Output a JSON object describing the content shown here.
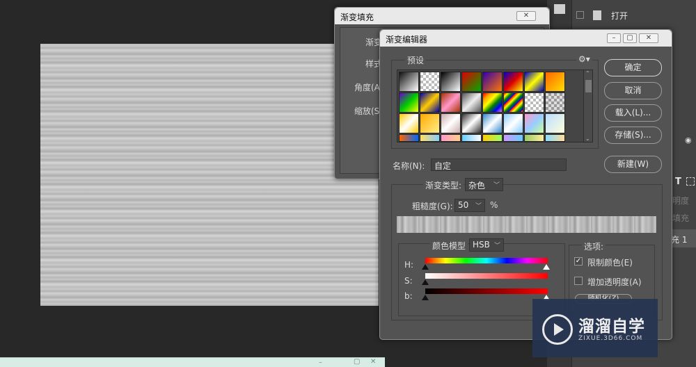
{
  "right_panel": {
    "open_label": "打开",
    "partial_labels": [
      "明度",
      "填充",
      "充 1"
    ],
    "partial_letters": "T"
  },
  "gradient_fill": {
    "title": "渐变填充",
    "labels": [
      "渐变",
      "样式",
      "角度(A)",
      "缩放(S)"
    ]
  },
  "editor": {
    "title": "渐变编辑器",
    "presets_label": "预设",
    "buttons": {
      "ok": "确定",
      "cancel": "取消",
      "load": "载入(L)...",
      "save": "存储(S)...",
      "new": "新建(W)"
    },
    "name_label": "名称(N):",
    "name_value": "自定",
    "type_label": "渐变类型:",
    "type_value": "杂色",
    "roughness_label": "粗糙度(G):",
    "roughness_value": "50",
    "roughness_unit": "%",
    "color_model_label": "颜色模型",
    "color_model_value": "HSB",
    "channels": [
      "H:",
      "S:",
      "b:"
    ],
    "options_label": "选项:",
    "restrict_colors": "限制颜色(E)",
    "add_transparency": "增加透明度(A)",
    "randomize": "随机化(Z)"
  },
  "watermark": {
    "brand": "溜溜自学",
    "site": "ZIXUE.3D66.COM"
  },
  "colors": {
    "dialog_bg": "#535353",
    "titlebar": "#e9e9e9",
    "workspace": "#282828"
  }
}
